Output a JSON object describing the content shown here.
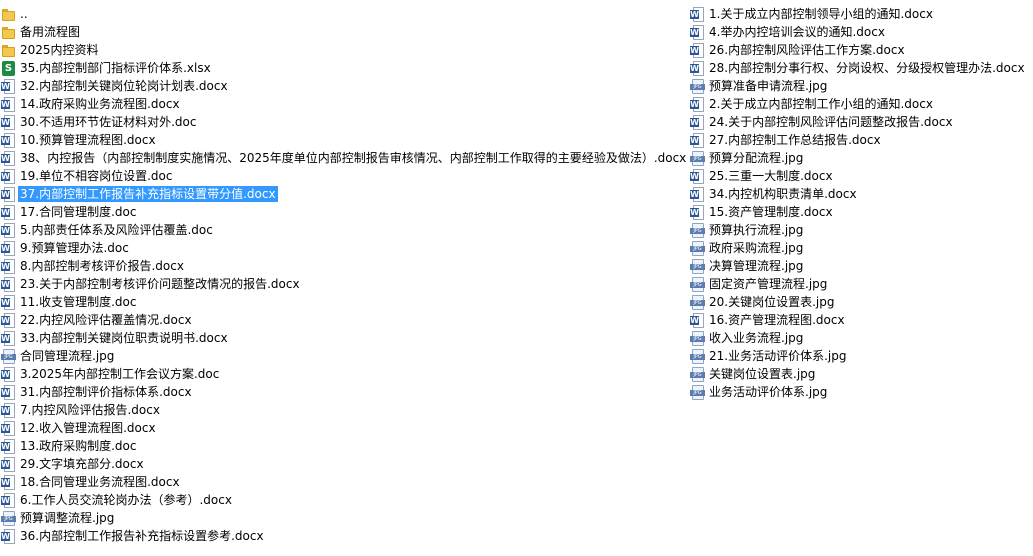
{
  "colors": {
    "selection": "#3399ff",
    "folder": "#f2c94c",
    "word": "#2b5797",
    "excel": "#1e8a45",
    "jpg": "#5c7cb0"
  },
  "columns": [
    [
      {
        "name": "..",
        "icon": "folder-icon"
      },
      {
        "name": "备用流程图",
        "icon": "folder-icon"
      },
      {
        "name": "2025内控资料",
        "icon": "folder-icon"
      },
      {
        "name": "35.内部控制部门指标评价体系.xlsx",
        "icon": "excel-file-icon"
      },
      {
        "name": "32.内部控制关键岗位轮岗计划表.docx",
        "icon": "word-file-icon"
      },
      {
        "name": "14.政府采购业务流程图.docx",
        "icon": "word-file-icon"
      },
      {
        "name": "30.不适用环节佐证材料对外.doc",
        "icon": "word-file-icon"
      },
      {
        "name": "10.预算管理流程图.docx",
        "icon": "word-file-icon"
      },
      {
        "name": "38、内控报告（内部控制制度实施情况、2025年度单位内部控制报告审核情况、内部控制工作取得的主要经验及做法）.docx",
        "icon": "word-file-icon"
      },
      {
        "name": "19.单位不相容岗位设置.doc",
        "icon": "word-file-icon"
      },
      {
        "name": "37.内部控制工作报告补充指标设置带分值.docx",
        "icon": "word-file-icon",
        "selected": true
      },
      {
        "name": "17.合同管理制度.doc",
        "icon": "word-file-icon"
      },
      {
        "name": "5.内部责任体系及风险评估覆盖.doc",
        "icon": "word-file-icon"
      },
      {
        "name": "9.预算管理办法.doc",
        "icon": "word-file-icon"
      },
      {
        "name": "8.内部控制考核评价报告.docx",
        "icon": "word-file-icon"
      },
      {
        "name": "23.关于内部控制考核评价问题整改情况的报告.docx",
        "icon": "word-file-icon"
      },
      {
        "name": "11.收支管理制度.doc",
        "icon": "word-file-icon"
      },
      {
        "name": "22.内控风险评估覆盖情况.docx",
        "icon": "word-file-icon"
      },
      {
        "name": "33.内部控制关键岗位职责说明书.docx",
        "icon": "word-file-icon"
      },
      {
        "name": "合同管理流程.jpg",
        "icon": "jpg-file-icon"
      },
      {
        "name": "3.2025年内部控制工作会议方案.doc",
        "icon": "word-file-icon"
      },
      {
        "name": "31.内部控制评价指标体系.docx",
        "icon": "word-file-icon"
      },
      {
        "name": "7.内控风险评估报告.docx",
        "icon": "word-file-icon"
      },
      {
        "name": "12.收入管理流程图.docx",
        "icon": "word-file-icon"
      },
      {
        "name": "13.政府采购制度.doc",
        "icon": "word-file-icon"
      },
      {
        "name": "29.文字填充部分.docx",
        "icon": "word-file-icon"
      },
      {
        "name": "18.合同管理业务流程图.docx",
        "icon": "word-file-icon"
      },
      {
        "name": "6.工作人员交流轮岗办法（参考）.docx",
        "icon": "word-file-icon"
      },
      {
        "name": "预算调整流程.jpg",
        "icon": "jpg-file-icon"
      },
      {
        "name": "36.内部控制工作报告补充指标设置参考.docx",
        "icon": "word-file-icon"
      }
    ],
    [
      {
        "name": "1.关于成立内部控制领导小组的通知.docx",
        "icon": "word-file-icon"
      },
      {
        "name": "4.举办内控培训会议的通知.docx",
        "icon": "word-file-icon"
      },
      {
        "name": "26.内部控制风险评估工作方案.docx",
        "icon": "word-file-icon"
      },
      {
        "name": "28.内部控制分事行权、分岗设权、分级授权管理办法.docx",
        "icon": "word-file-icon"
      },
      {
        "name": "预算准备申请流程.jpg",
        "icon": "jpg-file-icon"
      },
      {
        "name": "2.关于成立内部控制工作小组的通知.docx",
        "icon": "word-file-icon"
      },
      {
        "name": "24.关于内部控制风险评估问题整改报告.docx",
        "icon": "word-file-icon"
      },
      {
        "name": "27.内部控制工作总结报告.docx",
        "icon": "word-file-icon"
      },
      {
        "name": "预算分配流程.jpg",
        "icon": "jpg-file-icon"
      },
      {
        "name": "25.三重一大制度.docx",
        "icon": "word-file-icon"
      },
      {
        "name": "34.内控机构职责清单.docx",
        "icon": "word-file-icon"
      },
      {
        "name": "15.资产管理制度.docx",
        "icon": "word-file-icon"
      },
      {
        "name": "预算执行流程.jpg",
        "icon": "jpg-file-icon"
      },
      {
        "name": "政府采购流程.jpg",
        "icon": "jpg-file-icon"
      },
      {
        "name": "决算管理流程.jpg",
        "icon": "jpg-file-icon"
      },
      {
        "name": "固定资产管理流程.jpg",
        "icon": "jpg-file-icon"
      },
      {
        "name": "20.关键岗位设置表.jpg",
        "icon": "jpg-file-icon"
      },
      {
        "name": "16.资产管理流程图.docx",
        "icon": "word-file-icon"
      },
      {
        "name": "收入业务流程.jpg",
        "icon": "jpg-file-icon"
      },
      {
        "name": "21.业务活动评价体系.jpg",
        "icon": "jpg-file-icon"
      },
      {
        "name": "关键岗位设置表.jpg",
        "icon": "jpg-file-icon"
      },
      {
        "name": "业务活动评价体系.jpg",
        "icon": "jpg-file-icon"
      }
    ]
  ]
}
